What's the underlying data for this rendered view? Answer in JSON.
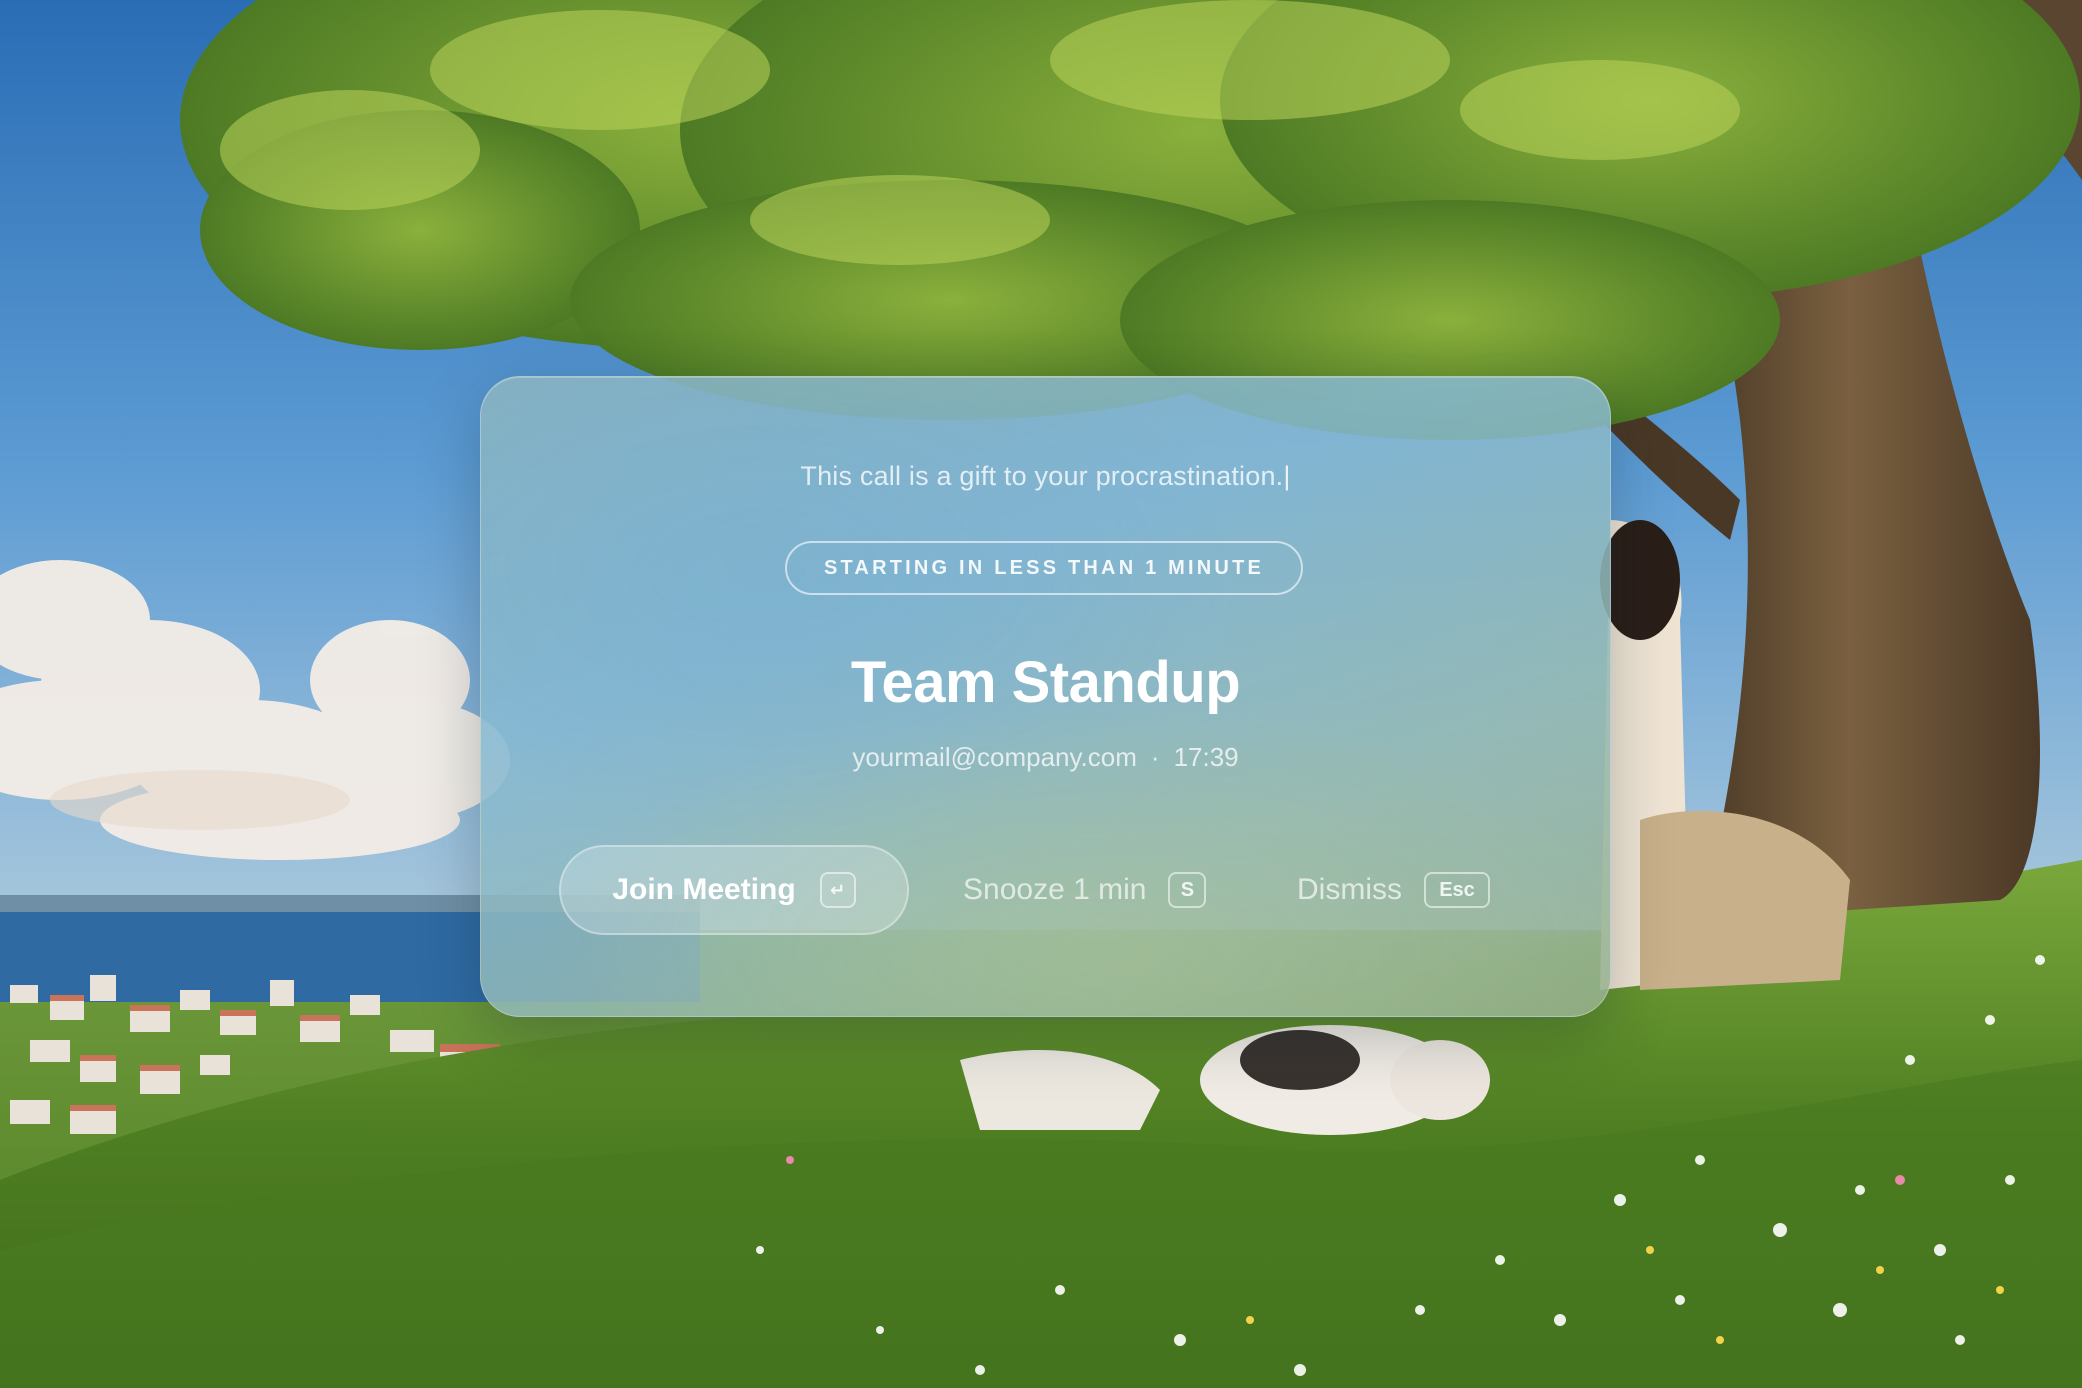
{
  "notification": {
    "tagline": "This call is a gift to your procrastination.",
    "caret": "|",
    "status": "STARTING IN LESS THAN 1 MINUTE",
    "title": "Team Standup",
    "email": "yourmail@company.com",
    "separator": "·",
    "time": "17:39"
  },
  "actions": {
    "join": {
      "label": "Join Meeting",
      "shortcut": "↵"
    },
    "snooze": {
      "label": "Snooze 1 min",
      "shortcut": "S"
    },
    "dismiss": {
      "label": "Dismiss",
      "shortcut": "Esc"
    }
  },
  "colors": {
    "sky": "#4d92cf",
    "grass": "#5c8a2a",
    "foliage": "#6f9a2e",
    "trunk": "#5a4630",
    "card_tint": "#8cb6c8"
  }
}
